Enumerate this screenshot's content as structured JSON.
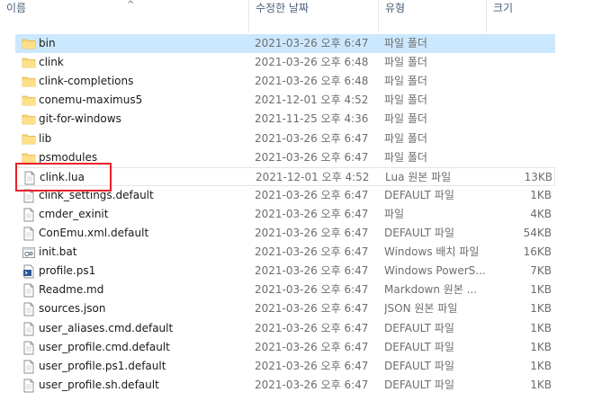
{
  "columns": {
    "name": "이름",
    "date": "수정한 날짜",
    "type": "유형",
    "size": "크기"
  },
  "sort_indicator": "^",
  "icons": {
    "folder": "folder-icon",
    "file": "file-icon",
    "bat": "batch-file-icon",
    "ps1": "powershell-script-icon"
  },
  "colors": {
    "selected_row": "#cce8ff",
    "highlight_box": "#e8202a",
    "folder": "#f8d775"
  },
  "files": [
    {
      "name": "bin",
      "date": "2021-03-26 오후 6:47",
      "type": "파일 폴더",
      "size": "",
      "icon": "folder"
    },
    {
      "name": "clink",
      "date": "2021-03-26 오후 6:48",
      "type": "파일 폴더",
      "size": "",
      "icon": "folder"
    },
    {
      "name": "clink-completions",
      "date": "2021-03-26 오후 6:48",
      "type": "파일 폴더",
      "size": "",
      "icon": "folder"
    },
    {
      "name": "conemu-maximus5",
      "date": "2021-12-01 오후 4:52",
      "type": "파일 폴더",
      "size": "",
      "icon": "folder"
    },
    {
      "name": "git-for-windows",
      "date": "2021-11-25 오후 4:36",
      "type": "파일 폴더",
      "size": "",
      "icon": "folder"
    },
    {
      "name": "lib",
      "date": "2021-03-26 오후 6:47",
      "type": "파일 폴더",
      "size": "",
      "icon": "folder"
    },
    {
      "name": "psmodules",
      "date": "2021-03-26 오후 6:47",
      "type": "파일 폴더",
      "size": "",
      "icon": "folder"
    },
    {
      "name": "clink.lua",
      "date": "2021-12-01 오후 4:52",
      "type": "Lua 원본 파일",
      "size": "13KB",
      "icon": "file"
    },
    {
      "name": "clink_settings.default",
      "date": "2021-03-26 오후 6:47",
      "type": "DEFAULT 파일",
      "size": "1KB",
      "icon": "file"
    },
    {
      "name": "cmder_exinit",
      "date": "2021-03-26 오후 6:47",
      "type": "파일",
      "size": "4KB",
      "icon": "file"
    },
    {
      "name": "ConEmu.xml.default",
      "date": "2021-03-26 오후 6:47",
      "type": "DEFAULT 파일",
      "size": "54KB",
      "icon": "file"
    },
    {
      "name": "init.bat",
      "date": "2021-03-26 오후 6:47",
      "type": "Windows 배치 파일",
      "size": "16KB",
      "icon": "bat"
    },
    {
      "name": "profile.ps1",
      "date": "2021-03-26 오후 6:47",
      "type": "Windows PowerS...",
      "size": "7KB",
      "icon": "ps1"
    },
    {
      "name": "Readme.md",
      "date": "2021-03-26 오후 6:47",
      "type": "Markdown 원본 ...",
      "size": "1KB",
      "icon": "file"
    },
    {
      "name": "sources.json",
      "date": "2021-03-26 오후 6:47",
      "type": "JSON 원본 파일",
      "size": "1KB",
      "icon": "file"
    },
    {
      "name": "user_aliases.cmd.default",
      "date": "2021-03-26 오후 6:47",
      "type": "DEFAULT 파일",
      "size": "1KB",
      "icon": "file"
    },
    {
      "name": "user_profile.cmd.default",
      "date": "2021-03-26 오후 6:47",
      "type": "DEFAULT 파일",
      "size": "1KB",
      "icon": "file"
    },
    {
      "name": "user_profile.ps1.default",
      "date": "2021-03-26 오후 6:47",
      "type": "DEFAULT 파일",
      "size": "1KB",
      "icon": "file"
    },
    {
      "name": "user_profile.sh.default",
      "date": "2021-03-26 오후 6:47",
      "type": "DEFAULT 파일",
      "size": "1KB",
      "icon": "file"
    }
  ]
}
